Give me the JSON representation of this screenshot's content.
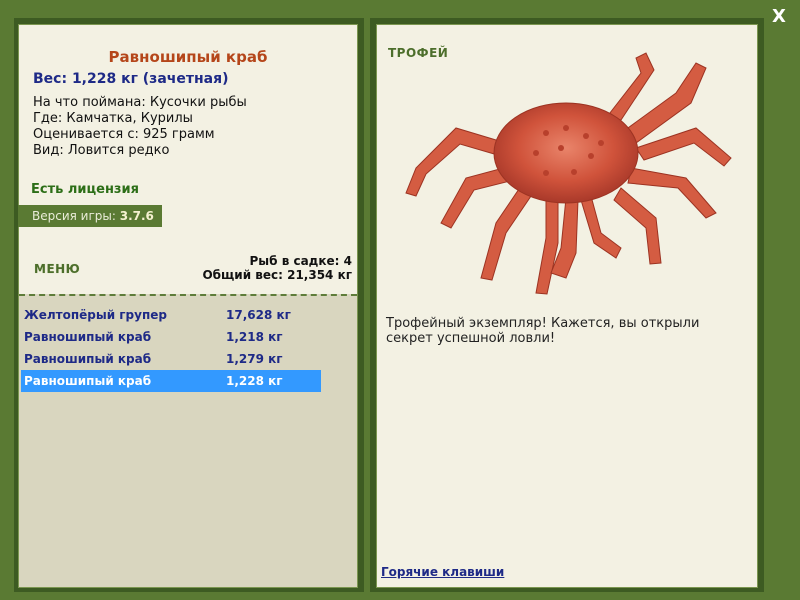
{
  "close_label": "X",
  "fish": {
    "title": "Равношипый краб",
    "weight_line": "Вес: 1,228 кг (зачетная)",
    "details": [
      "На что поймана: Кусочки рыбы",
      "Где: Камчатка, Курилы",
      "Оценивается с: 925 грамм",
      "Вид: Ловится редко"
    ]
  },
  "license": "Есть лицензия",
  "version": {
    "label": "Версия игры:",
    "value": "3.7.6"
  },
  "menu_label": "МЕНЮ",
  "tank": {
    "count_line": "Рыб в садке: 4",
    "total_line": "Общий вес: 21,354 кг"
  },
  "catches": [
    {
      "name": "Желтопёрый групер",
      "weight": "17,628 кг"
    },
    {
      "name": "Равношипый краб",
      "weight": "1,218 кг"
    },
    {
      "name": "Равношипый краб",
      "weight": "1,279 кг"
    },
    {
      "name": "Равношипый краб",
      "weight": "1,228 кг",
      "selected": true
    }
  ],
  "trophy_label": "ТРОФЕЙ",
  "trophy_text": "Трофейный экземпляр! Кажется, вы открыли секрет успешной ловли!",
  "hotkeys_label": "Горячие клавиши",
  "colors": {
    "frame": "#5a7a33",
    "panel": "#f3f1e3",
    "selection": "#3399ff",
    "title": "#b5461a",
    "name": "#1e2a87"
  }
}
